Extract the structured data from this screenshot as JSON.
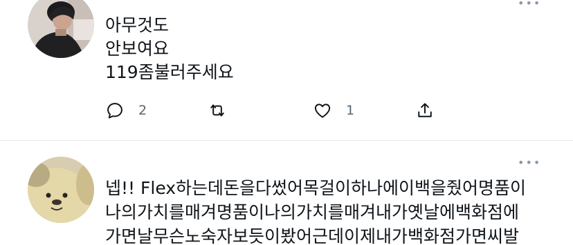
{
  "tweets": [
    {
      "lines": [
        "아무것도",
        "안보여요",
        "119좀불러주세요"
      ],
      "reply_count": "2",
      "retweet_count": "",
      "like_count": "1"
    },
    {
      "lines": [
        "넵!! Flex하는데돈을다썼어목걸이하나에이백을줬어명품이",
        "나의가치를매겨명품이나의가치를매겨내가옛날에백화점에",
        "가면날무슨노숙자보듯이봤어근데이제내가백화점가면씨발"
      ]
    }
  ],
  "icons": {
    "more": "more-icon",
    "reply": "reply-icon",
    "retweet": "retweet-icon",
    "like": "heart-icon",
    "share": "share-icon"
  },
  "colors": {
    "text": "#0f1419",
    "secondary": "#536471",
    "divider": "#e6ecf0"
  }
}
